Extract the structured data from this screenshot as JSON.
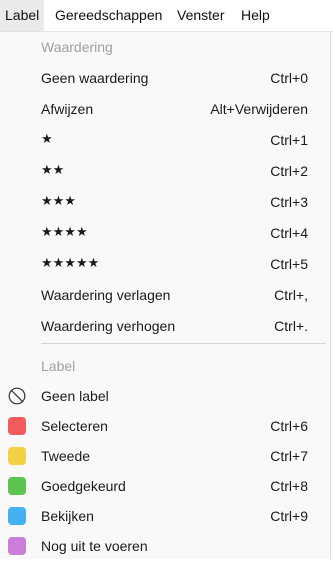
{
  "menubar": {
    "items": [
      {
        "label": "Label"
      },
      {
        "label": "Gereedschappen"
      },
      {
        "label": "Venster"
      },
      {
        "label": "Help"
      }
    ]
  },
  "rating_section": {
    "header": "Waardering",
    "items": [
      {
        "label": "Geen waardering",
        "shortcut": "Ctrl+0"
      },
      {
        "label": "Afwijzen",
        "shortcut": "Alt+Verwijderen"
      },
      {
        "label": "★",
        "shortcut": "Ctrl+1"
      },
      {
        "label": "★★",
        "shortcut": "Ctrl+2"
      },
      {
        "label": "★★★",
        "shortcut": "Ctrl+3"
      },
      {
        "label": "★★★★",
        "shortcut": "Ctrl+4"
      },
      {
        "label": "★★★★★",
        "shortcut": "Ctrl+5"
      },
      {
        "label": "Waardering verlagen",
        "shortcut": "Ctrl+,"
      },
      {
        "label": "Waardering verhogen",
        "shortcut": "Ctrl+."
      }
    ]
  },
  "label_section": {
    "header": "Label",
    "items": [
      {
        "label": "Geen label",
        "icon": "no-label-icon",
        "color": ""
      },
      {
        "label": "Selecteren",
        "shortcut": "Ctrl+6",
        "icon": "red-swatch-icon",
        "color": "#f25c5c"
      },
      {
        "label": "Tweede",
        "shortcut": "Ctrl+7",
        "icon": "yellow-swatch-icon",
        "color": "#f3d047"
      },
      {
        "label": "Goedgekeurd",
        "shortcut": "Ctrl+8",
        "icon": "green-swatch-icon",
        "color": "#5cc44f"
      },
      {
        "label": "Bekijken",
        "shortcut": "Ctrl+9",
        "icon": "blue-swatch-icon",
        "color": "#45b1f0"
      },
      {
        "label": "Nog uit te voeren",
        "icon": "purple-swatch-icon",
        "color": "#c97fd9"
      }
    ]
  }
}
